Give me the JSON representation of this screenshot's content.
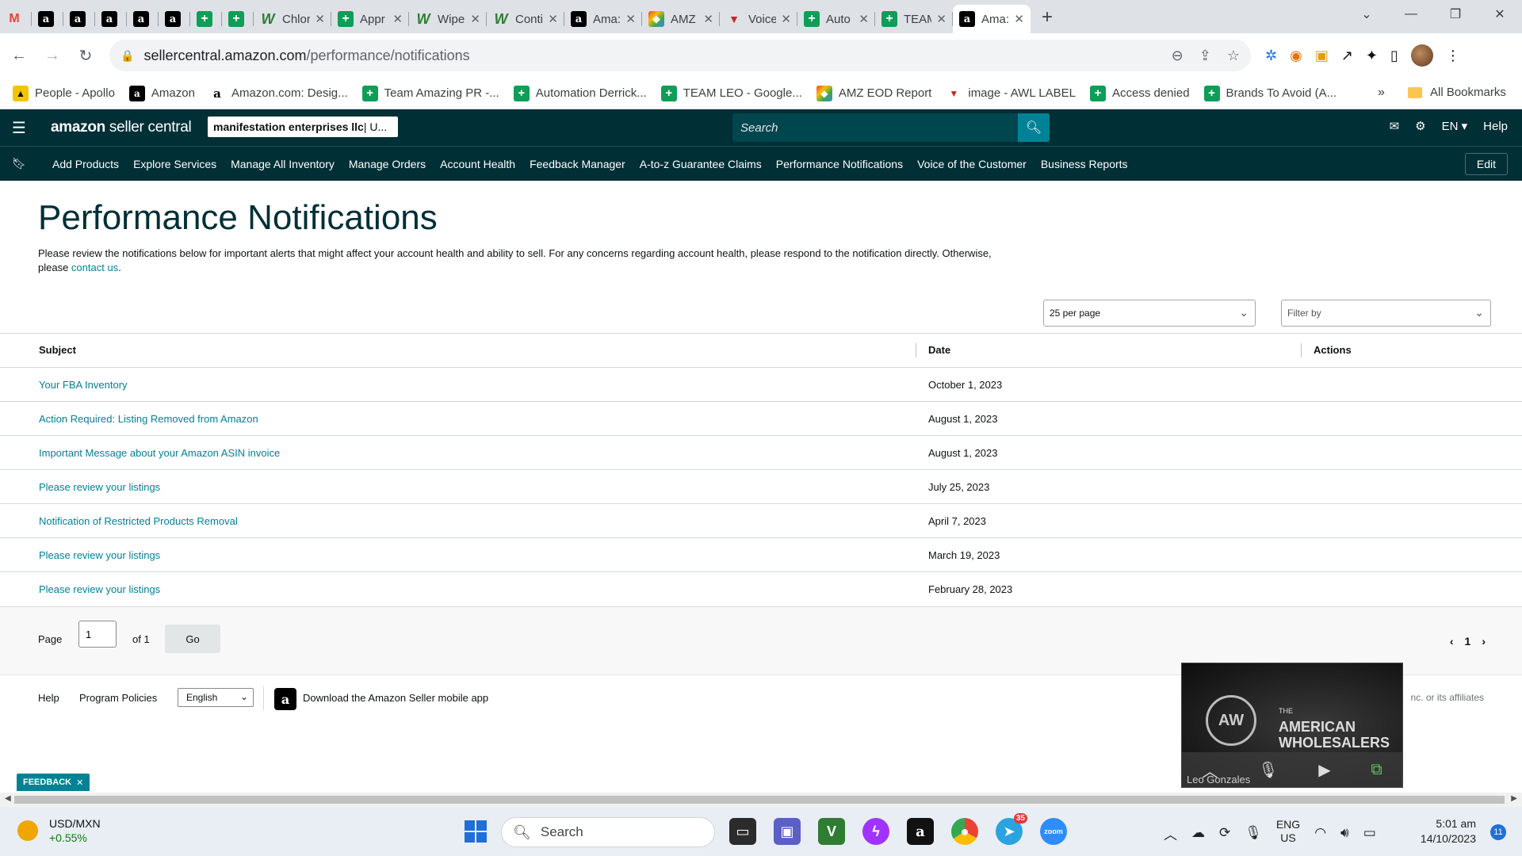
{
  "browser": {
    "tabs": [
      {
        "icon": "gmail-icon",
        "title": ""
      },
      {
        "icon": "amazon-icon",
        "title": ""
      },
      {
        "icon": "amazon-icon",
        "title": ""
      },
      {
        "icon": "amazon-icon",
        "title": ""
      },
      {
        "icon": "amazon-icon",
        "title": ""
      },
      {
        "icon": "amazon-icon",
        "title": ""
      },
      {
        "icon": "sheets-icon",
        "title": ""
      },
      {
        "icon": "sheets-icon",
        "title": ""
      },
      {
        "icon": "w-icon",
        "title": "Chlor"
      },
      {
        "icon": "sheets-icon",
        "title": "Appr"
      },
      {
        "icon": "w-icon",
        "title": "Wipe"
      },
      {
        "icon": "w-icon",
        "title": "Conti"
      },
      {
        "icon": "amazon-icon",
        "title": "Ama:"
      },
      {
        "icon": "amz-icon",
        "title": "AMZ"
      },
      {
        "icon": "voice-icon",
        "title": "Voice"
      },
      {
        "icon": "sheets-icon",
        "title": "Auto"
      },
      {
        "icon": "sheets-icon",
        "title": "TEAM"
      },
      {
        "icon": "amazon-icon",
        "title": "Ama:"
      }
    ],
    "url_domain": "sellercentral.amazon.com",
    "url_path": "/performance/notifications",
    "bookmarks": [
      {
        "icon": "apollo-icon",
        "label": "People - Apollo"
      },
      {
        "icon": "amazon-icon",
        "label": "Amazon"
      },
      {
        "icon": "amazon-a-icon",
        "label": "Amazon.com: Desig..."
      },
      {
        "icon": "sheets-icon",
        "label": "Team Amazing PR -..."
      },
      {
        "icon": "sheets-icon",
        "label": "Automation Derrick..."
      },
      {
        "icon": "sheets-icon",
        "label": "TEAM LEO - Google..."
      },
      {
        "icon": "amz-icon",
        "label": "AMZ EOD Report"
      },
      {
        "icon": "voice-icon",
        "label": "image - AWL LABEL"
      },
      {
        "icon": "sheets-icon",
        "label": "Access denied"
      },
      {
        "icon": "sheets-icon",
        "label": "Brands To Avoid (A..."
      }
    ],
    "bookmarks_more": "»",
    "all_bookmarks": "All Bookmarks"
  },
  "header": {
    "logo_brand": "amazon",
    "logo_product": " seller central",
    "merchant_name": "manifestation enterprises llc",
    "merchant_rest": " | U...",
    "search_placeholder": "Search",
    "language": "EN",
    "help": "Help"
  },
  "nav": {
    "links": [
      "Add Products",
      "Explore Services",
      "Manage All Inventory",
      "Manage Orders",
      "Account Health",
      "Feedback Manager",
      "A-to-z Guarantee Claims",
      "Performance Notifications",
      "Voice of the Customer",
      "Business Reports"
    ],
    "edit": "Edit"
  },
  "main": {
    "title": "Performance Notifications",
    "intro_text": "Please review the notifications below for important alerts that might affect your account health and ability to sell. For any concerns regarding account health, please respond to the notification directly. Otherwise, please ",
    "intro_link": "contact us",
    "intro_end": ".",
    "per_page": "25 per page",
    "filter_placeholder": "Filter by",
    "columns": {
      "subject": "Subject",
      "date": "Date",
      "actions": "Actions"
    },
    "rows": [
      {
        "subject": "Your FBA Inventory",
        "date": "October 1, 2023"
      },
      {
        "subject": "Action Required: Listing Removed from Amazon",
        "date": "August 1, 2023"
      },
      {
        "subject": "Important Message about your Amazon ASIN invoice",
        "date": "August 1, 2023"
      },
      {
        "subject": "Please review your listings",
        "date": "July 25, 2023"
      },
      {
        "subject": "Notification of Restricted Products Removal",
        "date": "April 7, 2023"
      },
      {
        "subject": "Please review your listings",
        "date": "March 19, 2023"
      },
      {
        "subject": "Please review your listings",
        "date": "February 28, 2023"
      }
    ],
    "pager": {
      "label": "Page",
      "value": "1",
      "of": "of 1",
      "go": "Go",
      "current": "1"
    }
  },
  "footer": {
    "help": "Help",
    "policies": "Program Policies",
    "language": "English",
    "app_text": "Download the Amazon Seller mobile app",
    "copyright": "nc. or its affiliates",
    "feedback": "FEEDBACK"
  },
  "video": {
    "brand_small": "THE",
    "brand_big": "AMERICAN WHOLESALERS",
    "badge": "AW",
    "participant": "Leo Gonzales"
  },
  "taskbar": {
    "ticker_name": "USD/MXN",
    "ticker_change": "+0.55%",
    "search": "Search",
    "telegram_badge": "35",
    "lang_line1": "ENG",
    "lang_line2": "US",
    "time": "5:01 am",
    "date": "14/10/2023",
    "notifications": "11"
  },
  "colors": {
    "header_bg": "#002f36",
    "link": "#008296",
    "sheets": "#0f9d58"
  }
}
